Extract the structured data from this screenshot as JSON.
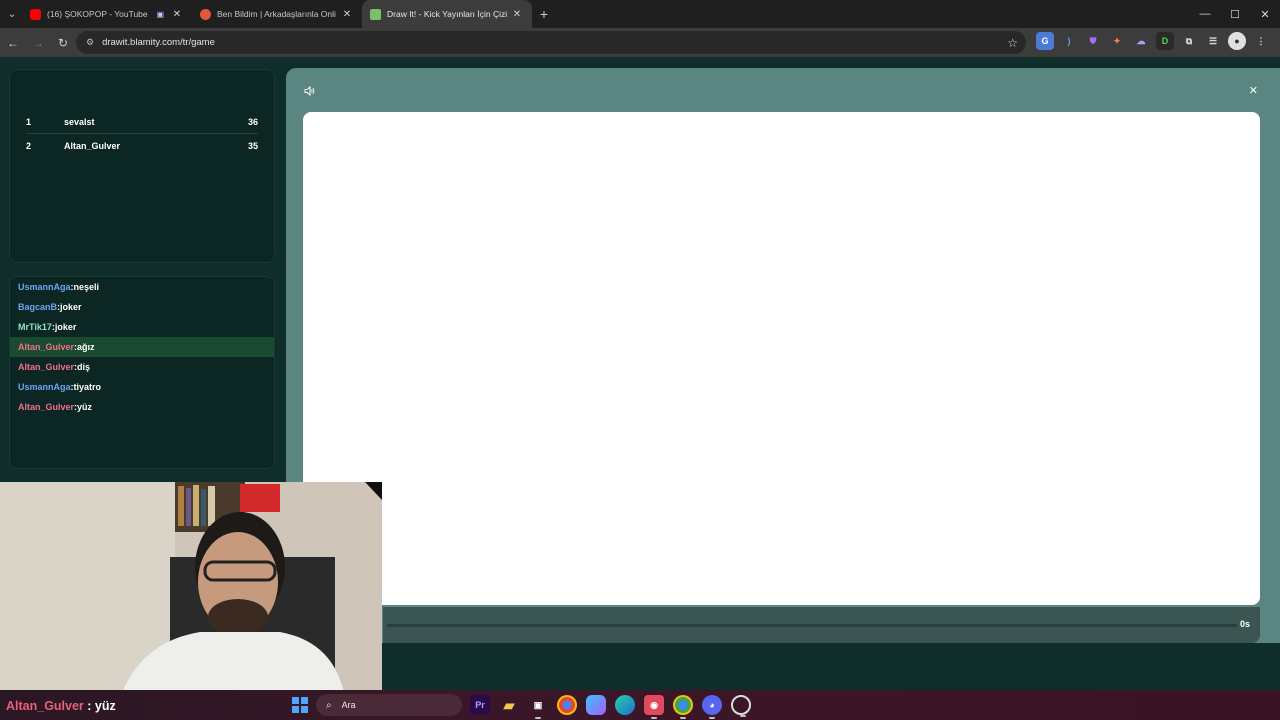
{
  "browser": {
    "tabs": [
      {
        "title": "(16) ŞOKOPOP - YouTube",
        "favicon_color": "#ff0000",
        "active": false,
        "media_icon": "▣"
      },
      {
        "title": "Ben Bildim | Arkadaşlarınla Onli",
        "favicon_color": "#e0583a",
        "active": false
      },
      {
        "title": "Draw It! - Kick Yayınları İçin Çizi",
        "favicon_color": "#7bbf6a",
        "active": true
      }
    ],
    "new_tab": "+",
    "url": "drawit.blamity.com/tr/game"
  },
  "game": {
    "leaderboard": [
      {
        "rank": "1",
        "name": "sevalst",
        "score": "36"
      },
      {
        "rank": "2",
        "name": "Altan_Gulver",
        "score": "35"
      }
    ],
    "chat": [
      {
        "user": "UsmannAga",
        "sep": ":",
        "text": "neşeli",
        "color": "blue"
      },
      {
        "user": "BagcanB",
        "sep": ":",
        "text": "joker",
        "color": "blue"
      },
      {
        "user": "MrTik17",
        "sep": ":",
        "text": "joker",
        "color": "green"
      },
      {
        "user": "Altan_Gulver",
        "sep": ":",
        "text": "ağız",
        "color": "pink",
        "highlight": true
      },
      {
        "user": "Altan_Gulver",
        "sep": ":",
        "text": "diş",
        "color": "pink"
      },
      {
        "user": "UsmannAga",
        "sep": ":",
        "text": "tiyatro",
        "color": "blue"
      },
      {
        "user": "Altan_Gulver",
        "sep": ":",
        "text": "yüz",
        "color": "pink"
      }
    ],
    "timer": "0s",
    "sound_icon": "speaker-icon",
    "close_icon": "close-icon"
  },
  "caption": {
    "user": "Altan_Gulver",
    "text": " : yüz"
  },
  "taskbar": {
    "search_placeholder": "Ara",
    "apps": [
      "Pr",
      "folder",
      "store",
      "chrome",
      "copilot",
      "edge",
      "kick",
      "chrome2",
      "discord",
      "obs"
    ]
  }
}
